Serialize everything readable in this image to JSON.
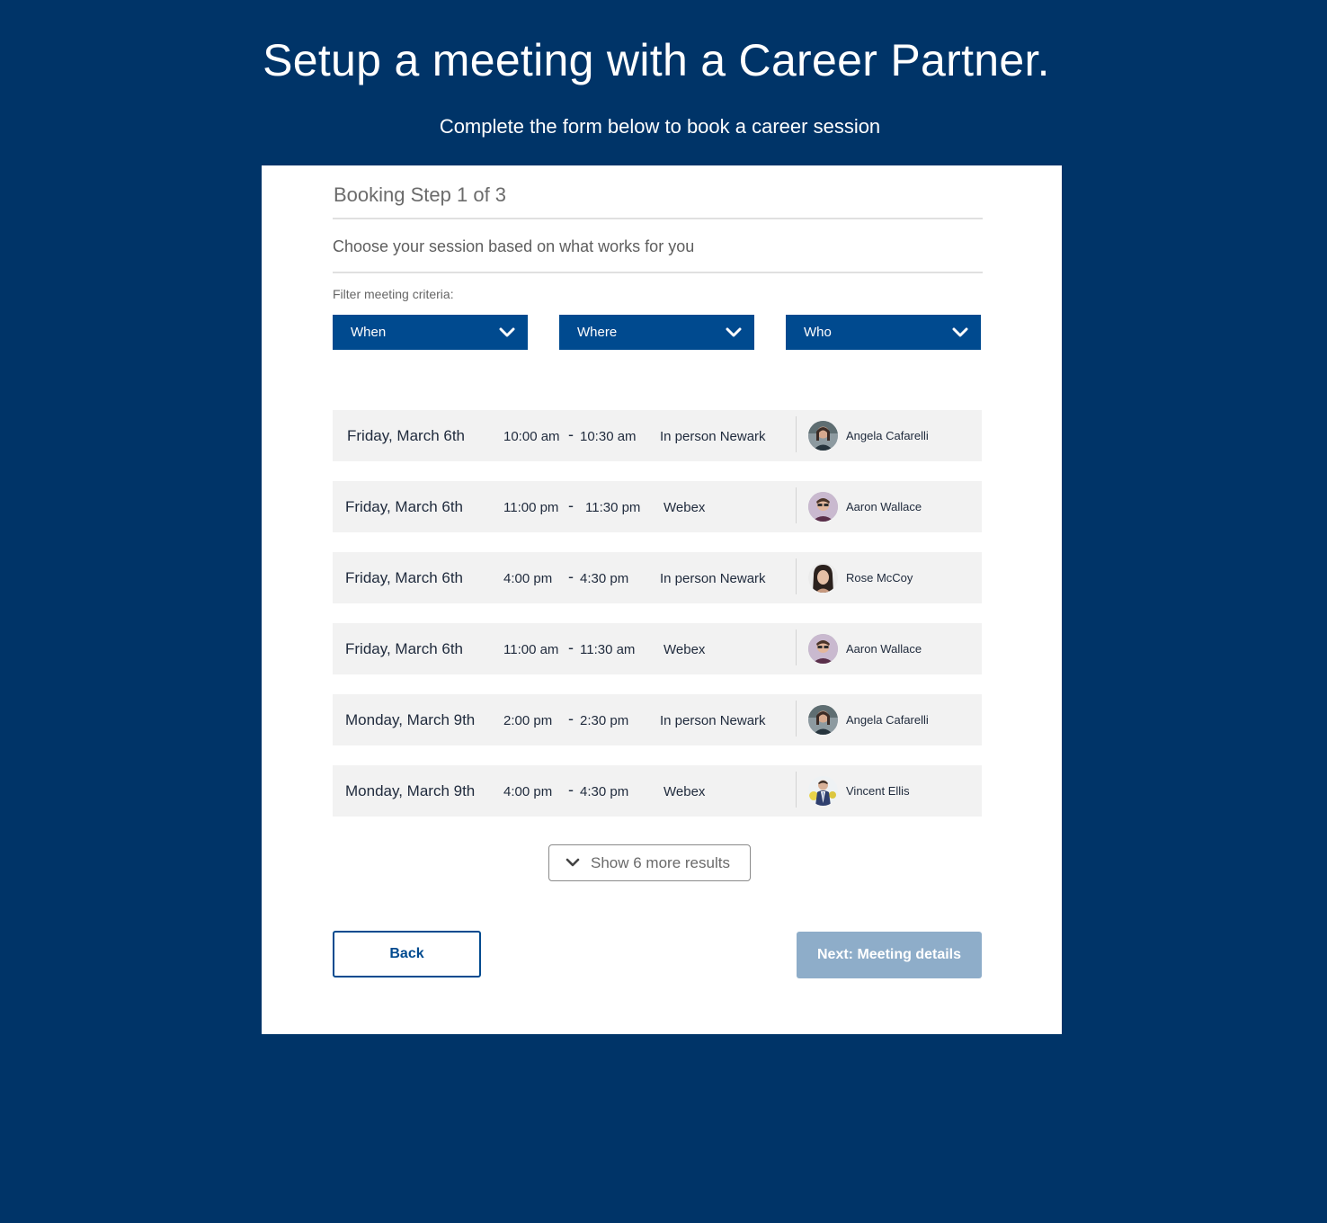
{
  "header": {
    "title": "Setup a meeting with a Career Partner.",
    "subtitle": "Complete the form below to book a career session"
  },
  "form": {
    "step_title": "Booking Step 1 of 3",
    "step_description": "Choose your session based on what works for you",
    "filter_label": "Filter meeting criteria:",
    "filters": [
      {
        "label": "When",
        "icon": "chevron-down-icon"
      },
      {
        "label": "Where",
        "icon": "chevron-down-icon"
      },
      {
        "label": "Who",
        "icon": "chevron-down-icon"
      }
    ],
    "sessions": [
      {
        "date": "Friday, March 6th",
        "start": "10:00 am",
        "separator": "-",
        "end": "10:30 am",
        "location": "In person Newark",
        "partner": "Angela Cafarelli",
        "avatar": "angela"
      },
      {
        "date": "Friday, March 6th",
        "start": "11:00 pm",
        "separator": "-",
        "end": "11:30 pm",
        "location": "Webex",
        "partner": "Aaron Wallace",
        "avatar": "aaron"
      },
      {
        "date": "Friday, March 6th",
        "start": "4:00 pm",
        "separator": "-",
        "end": "4:30 pm",
        "location": "In person Newark",
        "partner": "Rose McCoy",
        "avatar": "rose"
      },
      {
        "date": "Friday, March 6th",
        "start": "11:00 am",
        "separator": "-",
        "end": "11:30 am",
        "location": "Webex",
        "partner": "Aaron Wallace",
        "avatar": "aaron"
      },
      {
        "date": "Monday, March 9th",
        "start": "2:00 pm",
        "separator": "-",
        "end": "2:30 pm",
        "location": "In person Newark",
        "partner": "Angela Cafarelli",
        "avatar": "angela"
      },
      {
        "date": "Monday, March 9th",
        "start": "4:00 pm",
        "separator": "-",
        "end": "4:30 pm",
        "location": "Webex",
        "partner": "Vincent Ellis",
        "avatar": "vincent"
      }
    ],
    "show_more_label": "Show 6 more results",
    "back_label": "Back",
    "next_label": "Next: Meeting details"
  },
  "colors": {
    "background": "#003468",
    "filter_button": "#004a8f",
    "next_button_disabled": "#8eadc9",
    "row_background": "#f2f2f2"
  }
}
